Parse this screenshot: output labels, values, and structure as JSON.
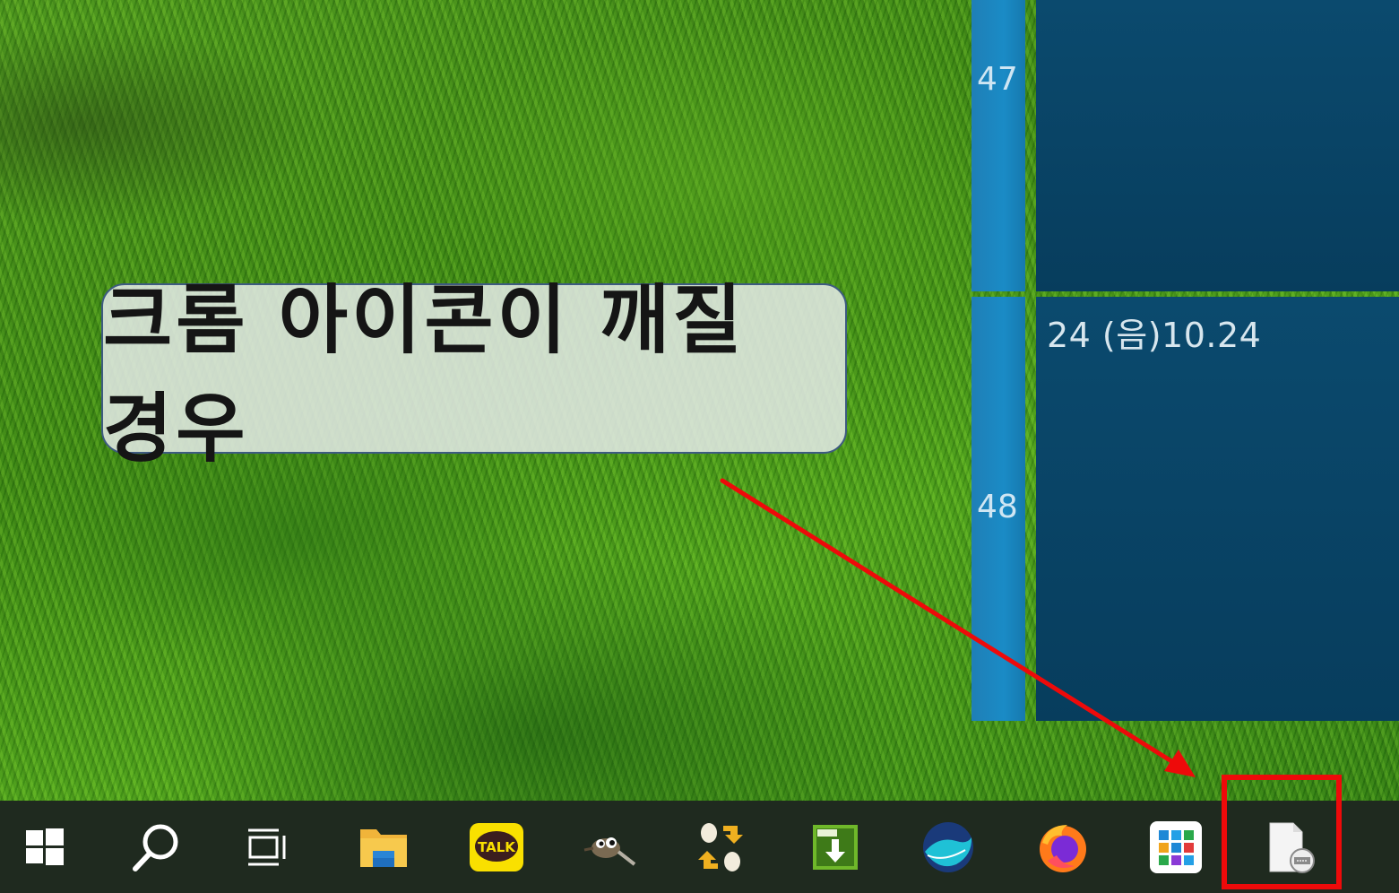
{
  "calendar": {
    "week_numbers": [
      "47",
      "48"
    ],
    "date_label": "24  (음)10.24"
  },
  "callout": {
    "text": "크롬 아이콘이 깨질 경우"
  },
  "taskbar": {
    "icons": [
      "windows-start-icon",
      "search-icon",
      "task-view-icon",
      "file-explorer-icon",
      "kakaotalk-icon",
      "gimp-icon",
      "swap-app-icon",
      "download-manager-icon",
      "whale-browser-icon",
      "firefox-icon",
      "app-grid-icon",
      "broken-chrome-icon"
    ],
    "kakaotalk_label": "TALK"
  },
  "colors": {
    "calendar_strip": "#1a8bc6",
    "calendar_panel": "#0b4a6e",
    "taskbar_bg": "#1f2a1f",
    "highlight": "#ee0a0a",
    "arrow": "#ee0a0a"
  }
}
